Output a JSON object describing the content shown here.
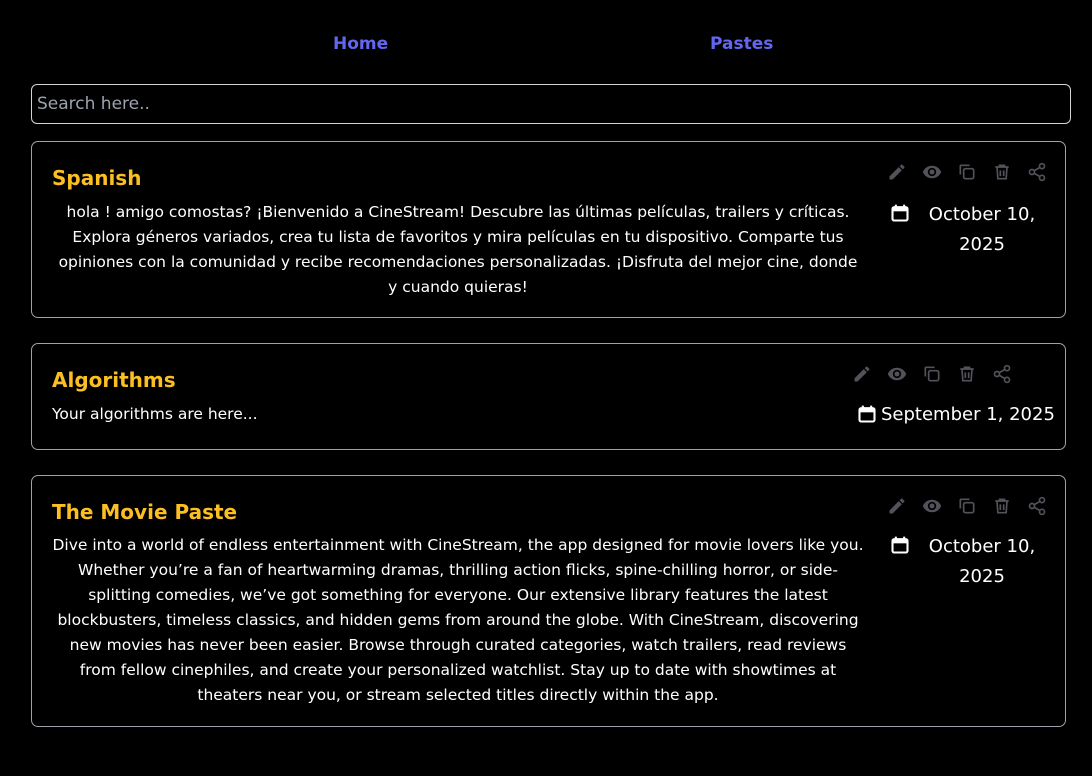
{
  "nav": {
    "home_label": "Home",
    "pastes_label": "Pastes"
  },
  "search": {
    "placeholder": "Search here..",
    "value": ""
  },
  "pastes": [
    {
      "title": "Spanish",
      "content": "hola ! amigo comostas? ¡Bienvenido a CineStream! Descubre las últimas películas, trailers y críticas. Explora géneros variados, crea tu lista de favoritos y mira películas en tu dispositivo. Comparte tus opiniones con la comunidad y recibe recomendaciones personalizadas. ¡Disfruta del mejor cine, donde y cuando quieras!",
      "date": "October 10, 2025"
    },
    {
      "title": "Algorithms",
      "content": "Your algorithms are here...",
      "date": "September 1, 2025"
    },
    {
      "title": "The Movie Paste",
      "content": "Dive into a world of endless entertainment with CineStream, the app designed for movie lovers like you. Whether you’re a fan of heartwarming dramas, thrilling action flicks, spine-chilling horror, or side-splitting comedies, we’ve got something for everyone. Our extensive library features the latest blockbusters, timeless classics, and hidden gems from around the globe. With CineStream, discovering new movies has never been easier. Browse through curated categories, watch trailers, read reviews from fellow cinephiles, and create your personalized watchlist. Stay up to date with showtimes at theaters near you, or stream selected titles directly within the app.",
      "date": "October 10, 2025"
    }
  ],
  "icons": {
    "edit": "edit-icon",
    "view": "eye-icon",
    "copy": "copy-icon",
    "delete": "trash-icon",
    "share": "share-icon",
    "calendar": "calendar-icon"
  },
  "colors": {
    "background": "#000000",
    "nav_link": "#6366f1",
    "title": "#fbbf24",
    "icon": "#52525b",
    "border": "#a1a1aa"
  }
}
